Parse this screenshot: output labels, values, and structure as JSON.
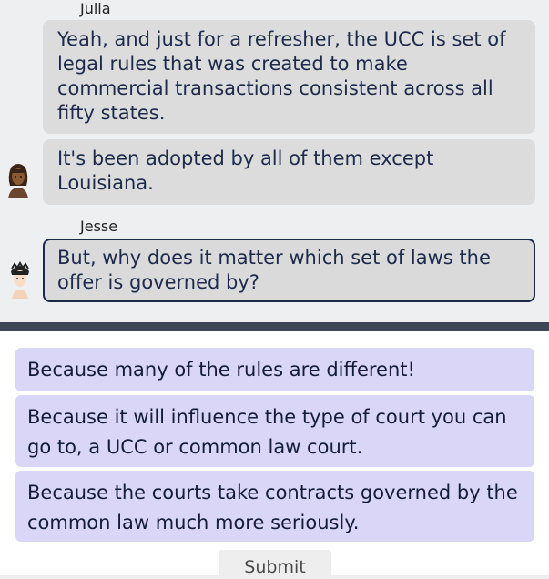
{
  "conversation": {
    "speaker_1": "Julia",
    "message_1": "Yeah, and just for a refresher, the UCC is set of legal rules that was created to make commercial transactions consistent across all fifty states.",
    "message_2": "It's been adopted by all of them except Louisiana.",
    "speaker_2": "Jesse",
    "message_3": "But, why does it matter which set of laws the offer is governed by?"
  },
  "choices": [
    "Because many of the rules are different!",
    "Because it will influence the type of court you can go to, a UCC or common law court.",
    "Because the courts take contracts governed by the common law much more seriously."
  ],
  "submit_label": "Submit",
  "colors": {
    "chat_background": "#eeeff1",
    "bubble": "#dcdcdc",
    "active_border": "#1b2a4a",
    "divider": "#3b4657",
    "choice": "#dad6f7"
  },
  "icons": [
    "julia-avatar-icon",
    "jesse-avatar-icon"
  ]
}
